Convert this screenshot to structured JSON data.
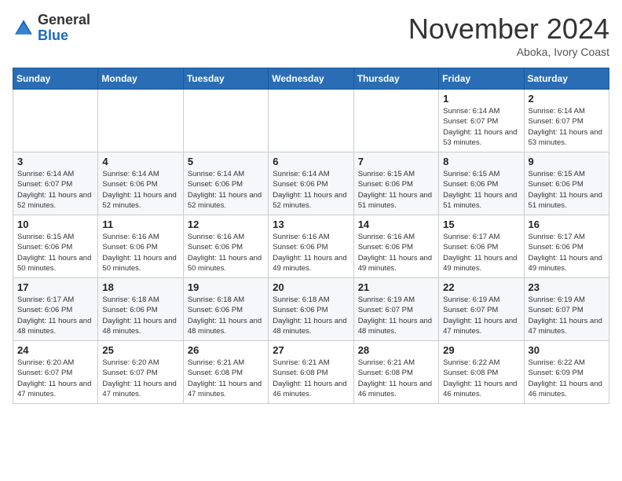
{
  "header": {
    "logo_general": "General",
    "logo_blue": "Blue",
    "month_title": "November 2024",
    "subtitle": "Aboka, Ivory Coast"
  },
  "weekdays": [
    "Sunday",
    "Monday",
    "Tuesday",
    "Wednesday",
    "Thursday",
    "Friday",
    "Saturday"
  ],
  "weeks": [
    [
      {
        "day": "",
        "info": ""
      },
      {
        "day": "",
        "info": ""
      },
      {
        "day": "",
        "info": ""
      },
      {
        "day": "",
        "info": ""
      },
      {
        "day": "",
        "info": ""
      },
      {
        "day": "1",
        "info": "Sunrise: 6:14 AM\nSunset: 6:07 PM\nDaylight: 11 hours and 53 minutes."
      },
      {
        "day": "2",
        "info": "Sunrise: 6:14 AM\nSunset: 6:07 PM\nDaylight: 11 hours and 53 minutes."
      }
    ],
    [
      {
        "day": "3",
        "info": "Sunrise: 6:14 AM\nSunset: 6:07 PM\nDaylight: 11 hours and 52 minutes."
      },
      {
        "day": "4",
        "info": "Sunrise: 6:14 AM\nSunset: 6:06 PM\nDaylight: 11 hours and 52 minutes."
      },
      {
        "day": "5",
        "info": "Sunrise: 6:14 AM\nSunset: 6:06 PM\nDaylight: 11 hours and 52 minutes."
      },
      {
        "day": "6",
        "info": "Sunrise: 6:14 AM\nSunset: 6:06 PM\nDaylight: 11 hours and 52 minutes."
      },
      {
        "day": "7",
        "info": "Sunrise: 6:15 AM\nSunset: 6:06 PM\nDaylight: 11 hours and 51 minutes."
      },
      {
        "day": "8",
        "info": "Sunrise: 6:15 AM\nSunset: 6:06 PM\nDaylight: 11 hours and 51 minutes."
      },
      {
        "day": "9",
        "info": "Sunrise: 6:15 AM\nSunset: 6:06 PM\nDaylight: 11 hours and 51 minutes."
      }
    ],
    [
      {
        "day": "10",
        "info": "Sunrise: 6:15 AM\nSunset: 6:06 PM\nDaylight: 11 hours and 50 minutes."
      },
      {
        "day": "11",
        "info": "Sunrise: 6:16 AM\nSunset: 6:06 PM\nDaylight: 11 hours and 50 minutes."
      },
      {
        "day": "12",
        "info": "Sunrise: 6:16 AM\nSunset: 6:06 PM\nDaylight: 11 hours and 50 minutes."
      },
      {
        "day": "13",
        "info": "Sunrise: 6:16 AM\nSunset: 6:06 PM\nDaylight: 11 hours and 49 minutes."
      },
      {
        "day": "14",
        "info": "Sunrise: 6:16 AM\nSunset: 6:06 PM\nDaylight: 11 hours and 49 minutes."
      },
      {
        "day": "15",
        "info": "Sunrise: 6:17 AM\nSunset: 6:06 PM\nDaylight: 11 hours and 49 minutes."
      },
      {
        "day": "16",
        "info": "Sunrise: 6:17 AM\nSunset: 6:06 PM\nDaylight: 11 hours and 49 minutes."
      }
    ],
    [
      {
        "day": "17",
        "info": "Sunrise: 6:17 AM\nSunset: 6:06 PM\nDaylight: 11 hours and 48 minutes."
      },
      {
        "day": "18",
        "info": "Sunrise: 6:18 AM\nSunset: 6:06 PM\nDaylight: 11 hours and 48 minutes."
      },
      {
        "day": "19",
        "info": "Sunrise: 6:18 AM\nSunset: 6:06 PM\nDaylight: 11 hours and 48 minutes."
      },
      {
        "day": "20",
        "info": "Sunrise: 6:18 AM\nSunset: 6:06 PM\nDaylight: 11 hours and 48 minutes."
      },
      {
        "day": "21",
        "info": "Sunrise: 6:19 AM\nSunset: 6:07 PM\nDaylight: 11 hours and 48 minutes."
      },
      {
        "day": "22",
        "info": "Sunrise: 6:19 AM\nSunset: 6:07 PM\nDaylight: 11 hours and 47 minutes."
      },
      {
        "day": "23",
        "info": "Sunrise: 6:19 AM\nSunset: 6:07 PM\nDaylight: 11 hours and 47 minutes."
      }
    ],
    [
      {
        "day": "24",
        "info": "Sunrise: 6:20 AM\nSunset: 6:07 PM\nDaylight: 11 hours and 47 minutes."
      },
      {
        "day": "25",
        "info": "Sunrise: 6:20 AM\nSunset: 6:07 PM\nDaylight: 11 hours and 47 minutes."
      },
      {
        "day": "26",
        "info": "Sunrise: 6:21 AM\nSunset: 6:08 PM\nDaylight: 11 hours and 47 minutes."
      },
      {
        "day": "27",
        "info": "Sunrise: 6:21 AM\nSunset: 6:08 PM\nDaylight: 11 hours and 46 minutes."
      },
      {
        "day": "28",
        "info": "Sunrise: 6:21 AM\nSunset: 6:08 PM\nDaylight: 11 hours and 46 minutes."
      },
      {
        "day": "29",
        "info": "Sunrise: 6:22 AM\nSunset: 6:08 PM\nDaylight: 11 hours and 46 minutes."
      },
      {
        "day": "30",
        "info": "Sunrise: 6:22 AM\nSunset: 6:09 PM\nDaylight: 11 hours and 46 minutes."
      }
    ]
  ]
}
